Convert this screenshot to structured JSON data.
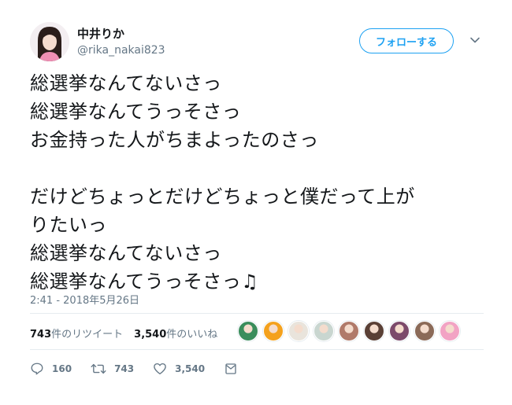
{
  "profile": {
    "name": "中井りか",
    "handle": "@rika_nakai823"
  },
  "follow_button": {
    "label": "フォローする"
  },
  "tweet": {
    "text": "総選挙なんてないさっ\n総選挙なんてうっそさっ\nお金持った人がちまよったのさっ\n\nだけどちょっとだけどちょっと僕だって上が\nりたいっ\n総選挙なんてないさっ\n総選挙なんてうっそさっ♫",
    "timestamp": "2:41 - 2018年5月26日"
  },
  "stats": {
    "retweets_count": "743",
    "retweets_label": "件のリツイート",
    "likes_count": "3,540",
    "likes_label": "件のいいね"
  },
  "likers": [
    {
      "color": "#3a8d5c"
    },
    {
      "color": "#f4a11d"
    },
    {
      "color": "#e9e4dc"
    },
    {
      "color": "#c9d6d0"
    },
    {
      "color": "#b07a6a"
    },
    {
      "color": "#5a4036"
    },
    {
      "color": "#7c4a6b"
    },
    {
      "color": "#8b6a58"
    },
    {
      "color": "#f2a3c4"
    }
  ],
  "actions": {
    "replies": "160",
    "retweets": "743",
    "likes": "3,540"
  },
  "colors": {
    "accent": "#1da1f2",
    "text_secondary": "#657786",
    "divider": "#e6ecf0"
  },
  "icons": {
    "reply": "speech-bubble",
    "retweet": "retweet-arrows",
    "like": "heart-outline",
    "dm": "envelope",
    "menu": "chevron-down"
  }
}
